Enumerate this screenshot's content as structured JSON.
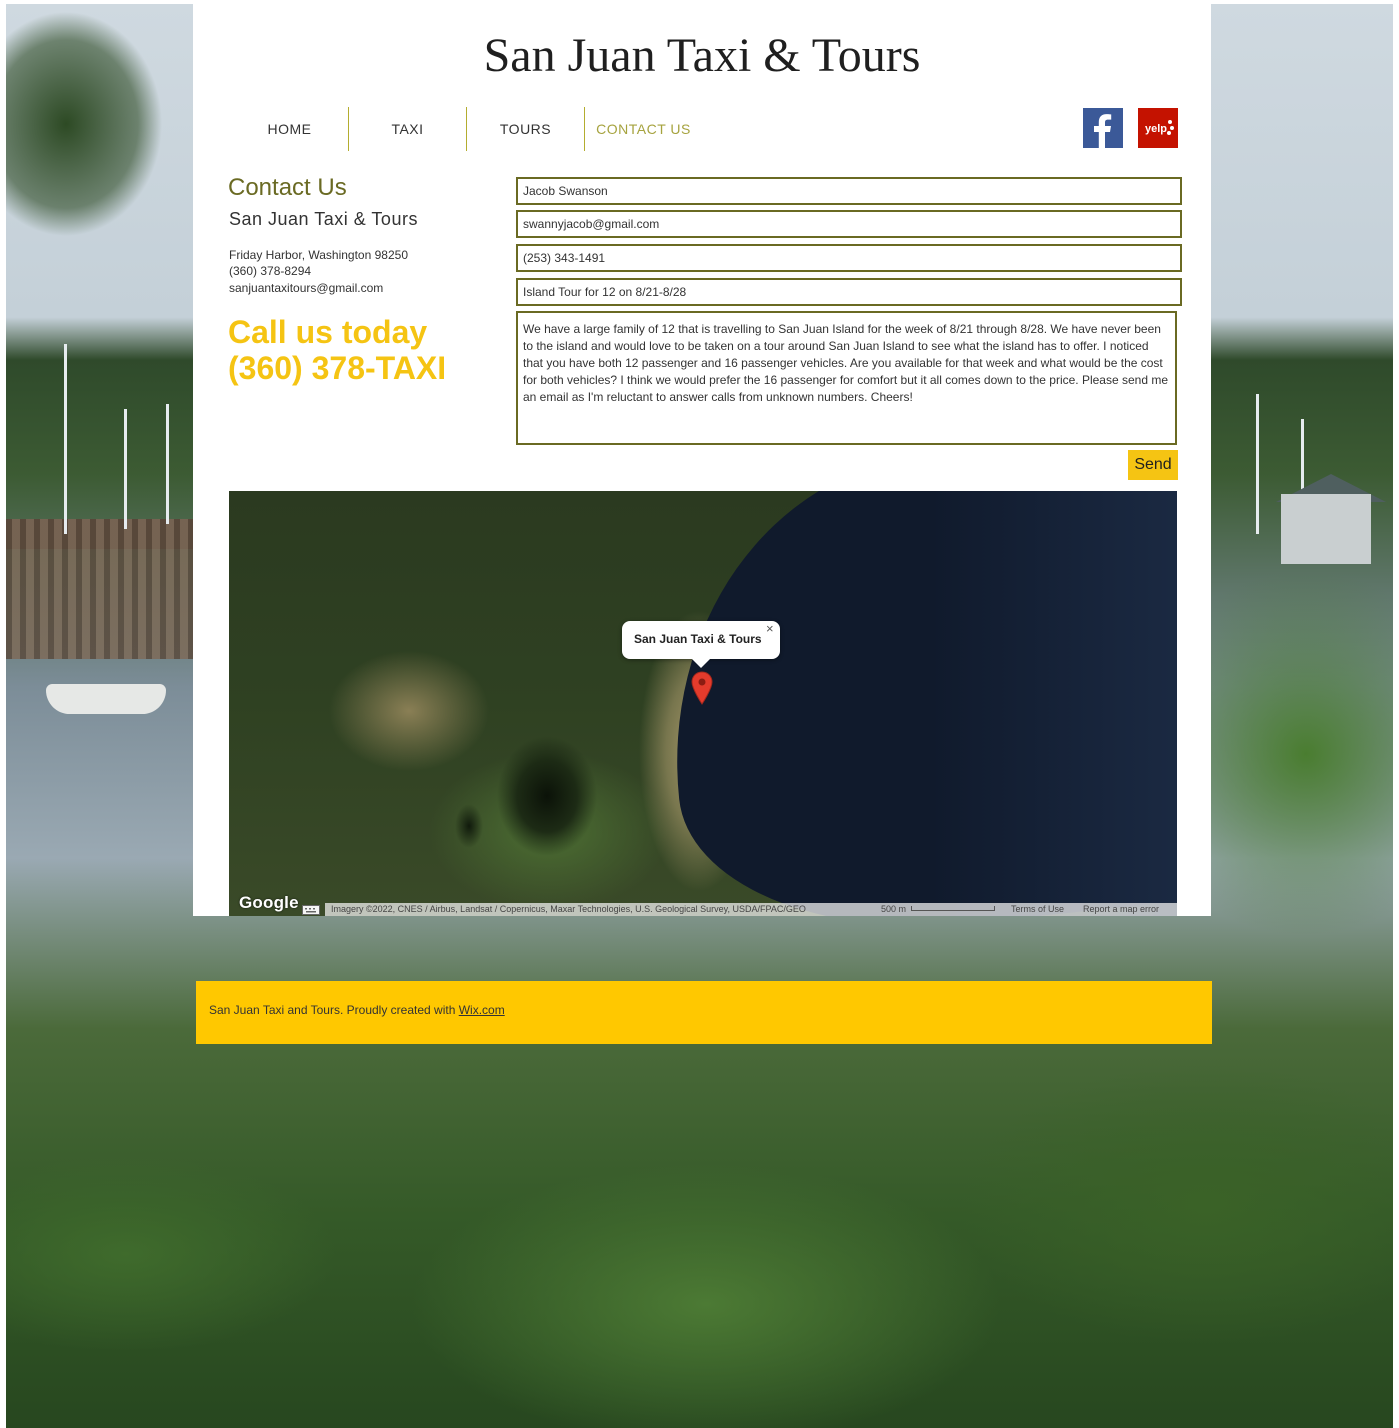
{
  "site": {
    "title": "San Juan Taxi & Tours"
  },
  "nav": {
    "items": [
      {
        "label": "HOME"
      },
      {
        "label": "TAXI"
      },
      {
        "label": "TOURS"
      },
      {
        "label": "CONTACT US"
      }
    ]
  },
  "social": {
    "facebook_icon": "facebook-icon",
    "yelp_icon": "yelp-icon",
    "yelp_text": "yelp"
  },
  "contact": {
    "heading": "Contact Us",
    "company": "San Juan Taxi & Tours",
    "address": "Friday Harbor, Washington 98250",
    "phone": "(360) 378-8294",
    "email": "sanjuantaxitours@gmail.com",
    "call_line1": "Call us today",
    "call_line2": "(360) 378-TAXI"
  },
  "form": {
    "name": "Jacob Swanson",
    "email": "swannyjacob@gmail.com",
    "phone": "(253) 343-1491",
    "subject": "Island Tour for 12 on 8/21-8/28",
    "message": "We have a large family of 12 that is travelling to San Juan Island for the week of 8/21 through 8/28. We have never been to the island and would love to be taken on a tour around San Juan Island to see what the island has to offer. I noticed that you have both 12 passenger and 16 passenger vehicles. Are you available for that week and what would be the cost for both vehicles? I think we would prefer the 16 passenger for comfort but it all comes down to the price. Please send me an email as I'm reluctant to answer calls from unknown numbers. Cheers!",
    "send_label": "Send"
  },
  "map": {
    "popup_title": "San Juan Taxi & Tours",
    "popup_close": "×",
    "google_logo": "Google",
    "attribution": "Imagery ©2022, CNES / Airbus, Landsat / Copernicus, Maxar Technologies, U.S. Geological Survey, USDA/FPAC/GEO",
    "scale": "500 m",
    "terms": "Terms of Use",
    "report": "Report a map error"
  },
  "footer": {
    "text": "San Juan Taxi and Tours. Proudly created with ",
    "link": "Wix.com"
  },
  "colors": {
    "accent_olive": "#6a6a23",
    "nav_active": "#a6a33f",
    "call_yellow": "#f5c413",
    "footer_bg": "#ffc800",
    "facebook_blue": "#3b5998",
    "yelp_red": "#c41200"
  }
}
